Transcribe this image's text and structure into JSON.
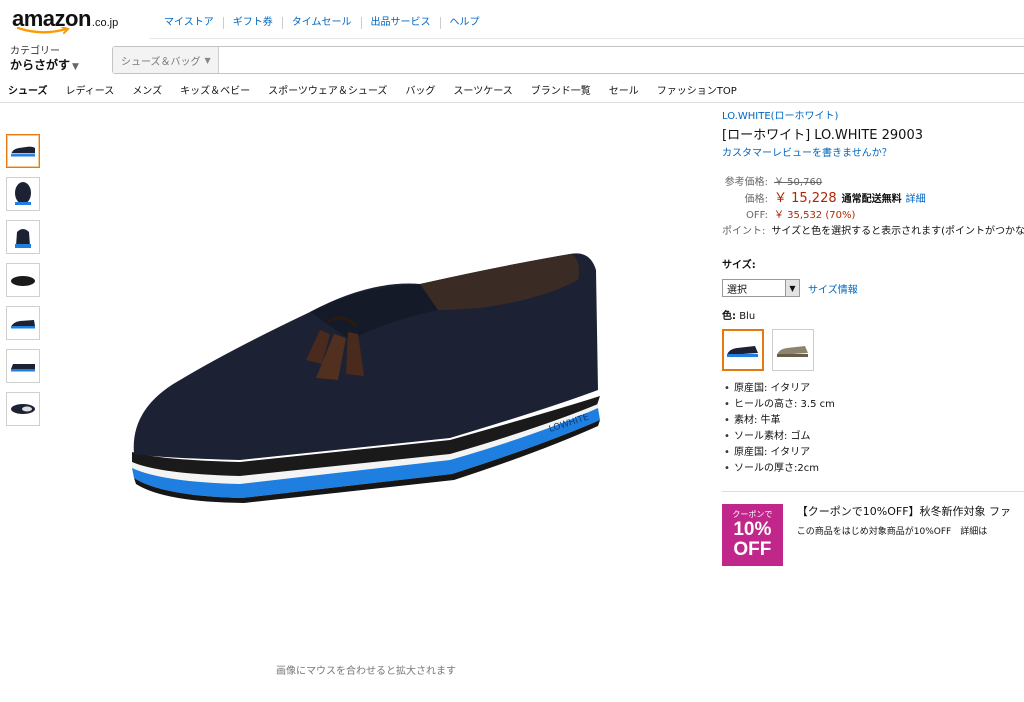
{
  "header": {
    "logo_word": "amazon",
    "logo_tld": ".co.jp",
    "top_links": [
      "マイストア",
      "ギフト券",
      "タイムセール",
      "出品サービス",
      "ヘルプ"
    ]
  },
  "browse": {
    "line1": "カテゴリー",
    "line2": "からさがす"
  },
  "search": {
    "scope": "シューズ＆バッグ",
    "value": ""
  },
  "subnav": [
    "シューズ",
    "レディース",
    "メンズ",
    "キッズ＆ベビー",
    "スポーツウェア＆シューズ",
    "バッグ",
    "スーツケース",
    "ブランド一覧",
    "セール",
    "ファッションTOP"
  ],
  "gallery": {
    "thumbnail_count": 7,
    "selected_index": 0,
    "zoom_hint": "画像にマウスを合わせると拡大されます"
  },
  "product": {
    "brand": "LO.WHITE(ローホワイト)",
    "title": "[ローホワイト] LO.WHITE 29003",
    "review_link": "カスタマーレビューを書きませんか？",
    "list_price_label": "参考価格:",
    "list_price": "￥ 50,760",
    "price_label": "価格:",
    "price": "￥ 15,228",
    "shipping": "通常配送無料",
    "details_link": "詳細",
    "off_label": "OFF:",
    "off_value": "￥ 35,532 (70%)",
    "points_label": "ポイント:",
    "points_text": "サイズと色を選択すると表示されます(ポイントがつかない",
    "size_label": "サイズ:",
    "size_select": "選択",
    "size_info": "サイズ情報",
    "color_label": "色:",
    "color_value": "Blu",
    "features": [
      "原産国: イタリア",
      "ヒールの高さ: 3.5 cm",
      "素材: 牛革",
      "ソール素材: ゴム",
      "原産国: イタリア",
      "ソールの厚さ:2cm"
    ]
  },
  "coupon": {
    "badge_line1": "クーポンで",
    "badge_line2": "10%",
    "badge_line3": "OFF",
    "headline": "【クーポンで10%OFF】秋冬新作対象 ファ",
    "subline": "この商品をはじめ対象商品が10%OFF　詳細は"
  },
  "colors": {
    "accent": "#e47911",
    "link": "#0066c0",
    "price": "#b12704",
    "coupon": "#c1278b",
    "sole": "#1f7fe0",
    "suede": "#1c2233"
  }
}
